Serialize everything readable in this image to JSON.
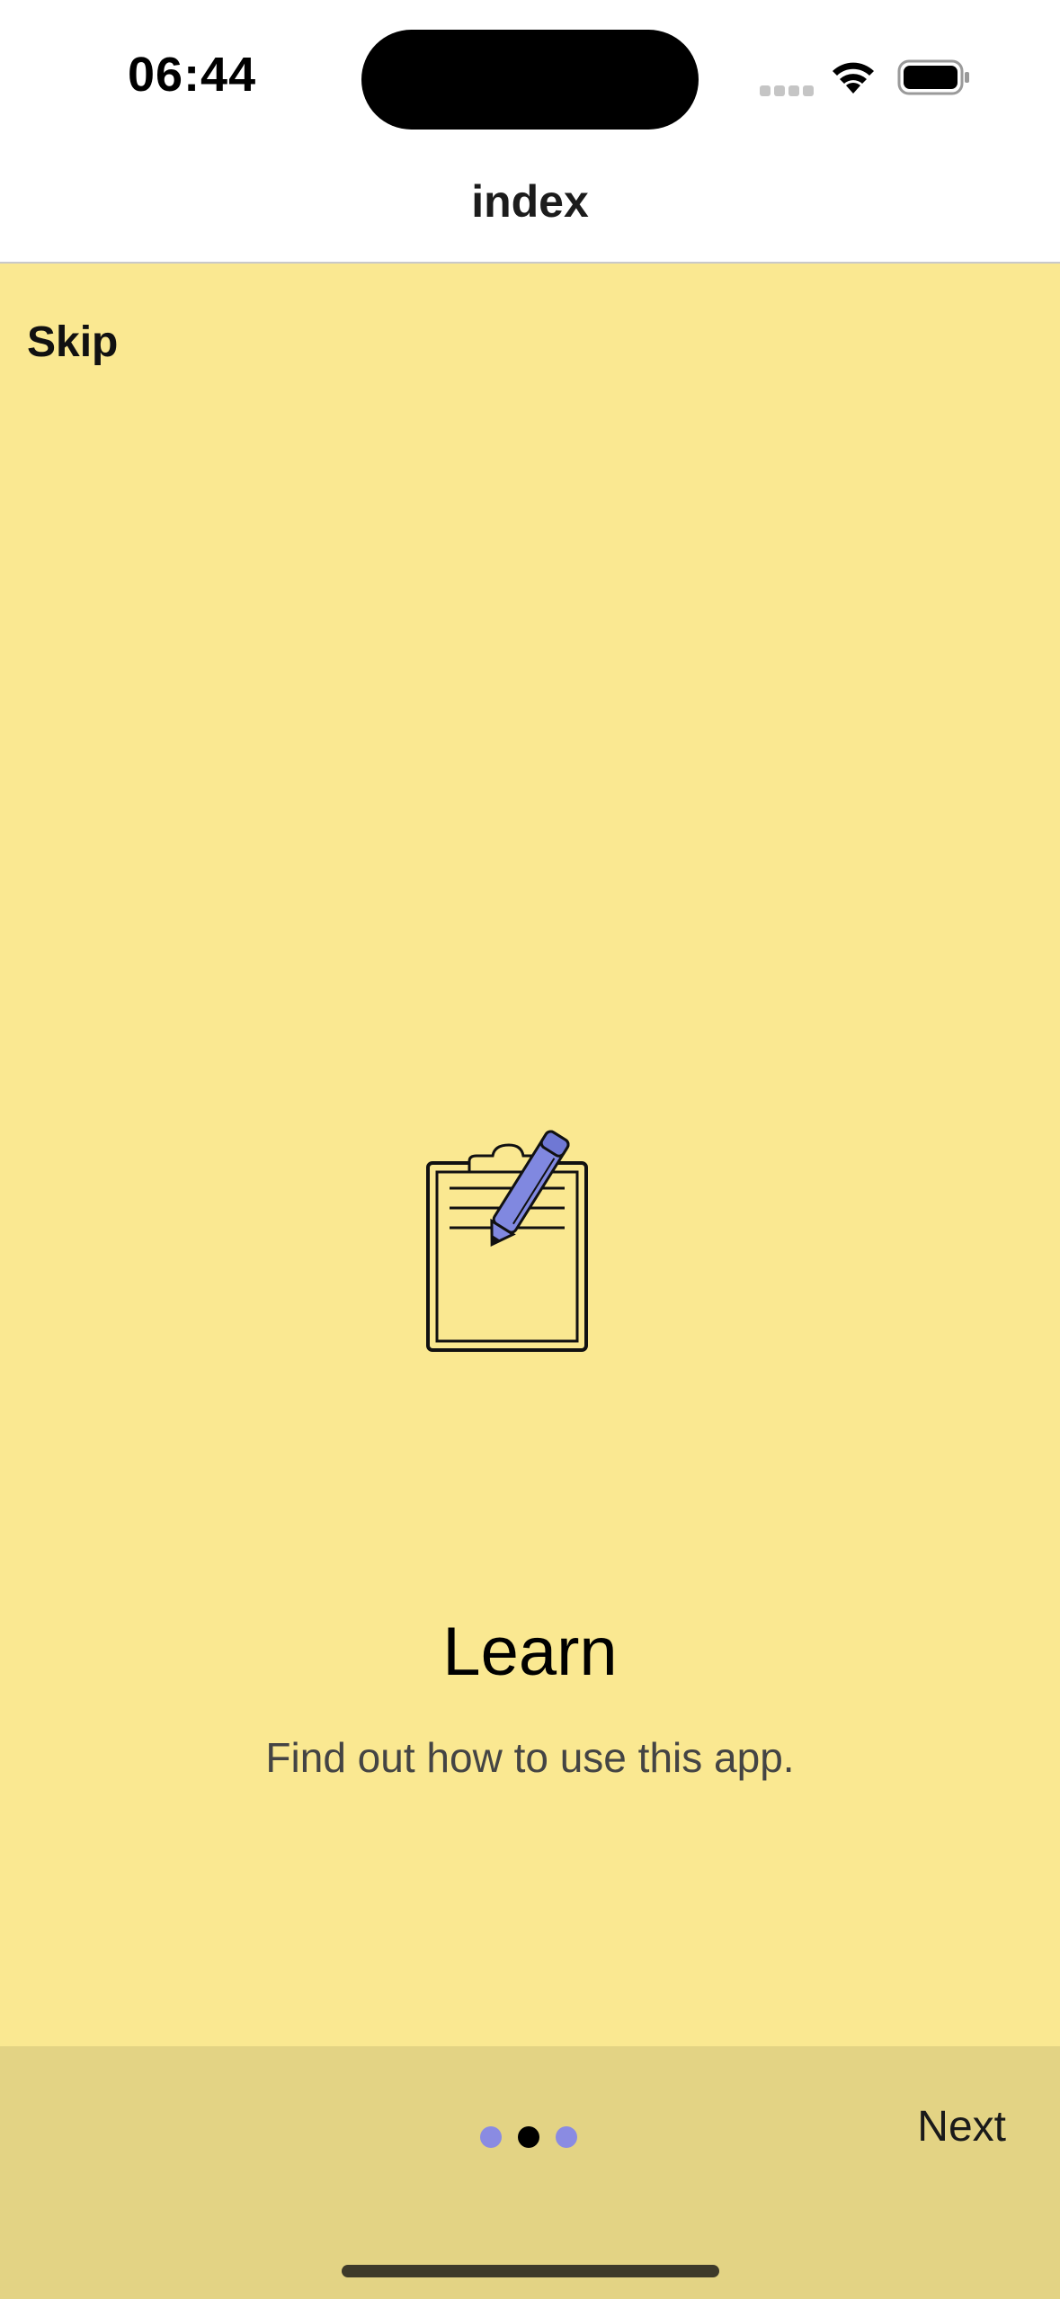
{
  "status_bar": {
    "time": "06:44"
  },
  "header": {
    "title": "index"
  },
  "slide": {
    "skip_label": "Skip",
    "title": "Learn",
    "subtitle": "Find out how to use this app.",
    "illustration": "clipboard-pencil-icon",
    "background_color": "#fae891"
  },
  "footer": {
    "next_label": "Next",
    "page_count": 3,
    "active_page": 2,
    "dot_color": "#8a8be2",
    "active_dot_color": "#000000",
    "background_color": "#e3d384"
  }
}
